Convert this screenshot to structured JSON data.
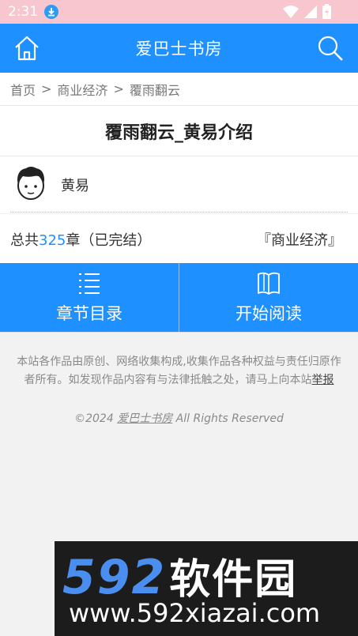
{
  "status_bar": {
    "time": "2:31"
  },
  "header": {
    "title": "爱巴士书房"
  },
  "breadcrumb": {
    "items": [
      "首页",
      "商业经济",
      "覆雨翻云"
    ],
    "separator": ">"
  },
  "book": {
    "title": "覆雨翻云_黄易介绍",
    "author": "黄易",
    "chapters_prefix": "总共",
    "chapter_count": "325",
    "chapters_suffix": "章（已完结）",
    "category": "『商业经济』"
  },
  "actions": {
    "toc_label": "章节目录",
    "read_label": "开始阅读"
  },
  "footer": {
    "disclaimer": "本站各作品由原创、网络收集构成,收集作品各种权益与责任归原作者所有。如发现作品内容有与法律抵触之处，请马上向本站",
    "report_label": "举报",
    "copyright_prefix": "©2024",
    "site_name": "爱巴士书房",
    "copyright_suffix": "All Rights Reserved"
  },
  "watermark": {
    "number": "592",
    "brand": "软件园",
    "url": "www.592xiazai.com"
  },
  "colors": {
    "primary": "#1e90ff",
    "status_bar": "#f7c6cf",
    "chapter_number": "#1e90ff"
  },
  "icons": [
    "download-icon",
    "wifi-icon",
    "signal-icon",
    "battery-icon",
    "home-icon",
    "search-icon",
    "list-icon",
    "book-icon"
  ]
}
